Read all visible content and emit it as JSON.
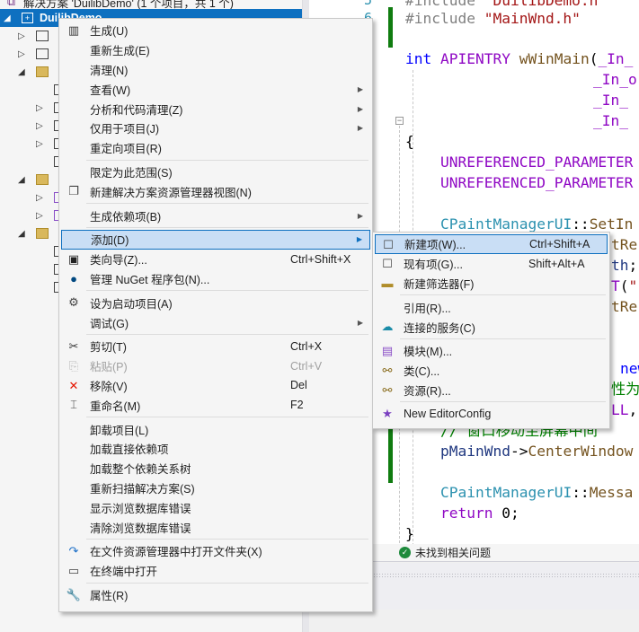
{
  "explorer": {
    "solution_label": "解决方案 'DuilibDemo' (1 个项目，共 1 个)",
    "project_label": "DuilibDemo",
    "selection_color": "#0e70c0"
  },
  "editor": {
    "line_numbers": [
      "5",
      "6"
    ],
    "status": "未找到相关问题"
  },
  "context_menu": {
    "items": [
      {
        "label": "生成(U)",
        "icon": "build-icon"
      },
      {
        "label": "重新生成(E)"
      },
      {
        "label": "清理(N)"
      },
      {
        "label": "查看(W)",
        "submenu": true
      },
      {
        "label": "分析和代码清理(Z)",
        "submenu": true
      },
      {
        "label": "仅用于项目(J)",
        "submenu": true
      },
      {
        "label": "重定向项目(R)"
      },
      {
        "sep": true
      },
      {
        "label": "限定为此范围(S)"
      },
      {
        "label": "新建解决方案资源管理器视图(N)",
        "icon": "new-view-icon"
      },
      {
        "sep": true
      },
      {
        "label": "生成依赖项(B)",
        "submenu": true
      },
      {
        "sep": true
      },
      {
        "label": "添加(D)",
        "submenu": true,
        "highlighted": true
      },
      {
        "label": "类向导(Z)...",
        "shortcut": "Ctrl+Shift+X",
        "icon": "class-wizard-icon"
      },
      {
        "label": "管理 NuGet 程序包(N)...",
        "icon": "nuget-icon"
      },
      {
        "sep": true
      },
      {
        "label": "设为启动项目(A)",
        "icon": "gear-icon"
      },
      {
        "label": "调试(G)",
        "submenu": true
      },
      {
        "sep": true
      },
      {
        "label": "剪切(T)",
        "shortcut": "Ctrl+X",
        "icon": "scissors-icon"
      },
      {
        "label": "粘贴(P)",
        "shortcut": "Ctrl+V",
        "icon": "paste-icon",
        "disabled": true
      },
      {
        "label": "移除(V)",
        "shortcut": "Del",
        "icon": "remove-icon"
      },
      {
        "label": "重命名(M)",
        "shortcut": "F2",
        "icon": "rename-icon"
      },
      {
        "sep": true
      },
      {
        "label": "卸载项目(L)"
      },
      {
        "label": "加载直接依赖项"
      },
      {
        "label": "加载整个依赖关系树"
      },
      {
        "label": "重新扫描解决方案(S)"
      },
      {
        "label": "显示浏览数据库错误"
      },
      {
        "label": "清除浏览数据库错误"
      },
      {
        "sep": true
      },
      {
        "label": "在文件资源管理器中打开文件夹(X)",
        "icon": "open-folder-icon"
      },
      {
        "label": "在终端中打开",
        "icon": "terminal-icon"
      },
      {
        "sep": true
      },
      {
        "label": "属性(R)",
        "icon": "wrench-icon"
      }
    ]
  },
  "add_submenu": {
    "items": [
      {
        "label": "新建项(W)...",
        "shortcut": "Ctrl+Shift+A",
        "icon": "new-item-icon",
        "highlighted": true
      },
      {
        "label": "现有项(G)...",
        "shortcut": "Shift+Alt+A",
        "icon": "existing-item-icon"
      },
      {
        "label": "新建筛选器(F)",
        "icon": "new-filter-icon"
      },
      {
        "sep": true
      },
      {
        "label": "引用(R)..."
      },
      {
        "label": "连接的服务(C)",
        "icon": "connected-service-icon"
      },
      {
        "sep": true
      },
      {
        "label": "模块(M)...",
        "icon": "module-icon"
      },
      {
        "label": "类(C)...",
        "icon": "class-icon"
      },
      {
        "label": "资源(R)...",
        "icon": "resource-icon"
      },
      {
        "sep": true
      },
      {
        "label": "New EditorConfig",
        "icon": "editorconfig-icon"
      }
    ]
  },
  "icons": {
    "build-icon": [
      "▥",
      "#333"
    ],
    "new-view-icon": [
      "❐",
      "#444"
    ],
    "class-wizard-icon": [
      "▣",
      "#222"
    ],
    "nuget-icon": [
      "●",
      "#004880"
    ],
    "gear-icon": [
      "⚙",
      "#444"
    ],
    "scissors-icon": [
      "✂",
      "#333"
    ],
    "paste-icon": [
      "⎘",
      "#bbb"
    ],
    "remove-icon": [
      "✕",
      "#e51400"
    ],
    "rename-icon": [
      "⌶",
      "#444"
    ],
    "open-folder-icon": [
      "↷",
      "#1e70c8"
    ],
    "terminal-icon": [
      "▭",
      "#444"
    ],
    "wrench-icon": [
      "🔧",
      "#444"
    ],
    "new-item-icon": [
      "☐",
      "#444"
    ],
    "existing-item-icon": [
      "☐",
      "#444"
    ],
    "new-filter-icon": [
      "▬",
      "#b08d2a"
    ],
    "connected-service-icon": [
      "☁",
      "#1a8ca8"
    ],
    "module-icon": [
      "▤",
      "#8a4fc7"
    ],
    "class-icon": [
      "⚯",
      "#8a6d1e"
    ],
    "resource-icon": [
      "⚯",
      "#8a6d1e"
    ],
    "editorconfig-icon": [
      "★",
      "#7a3fc0"
    ]
  }
}
